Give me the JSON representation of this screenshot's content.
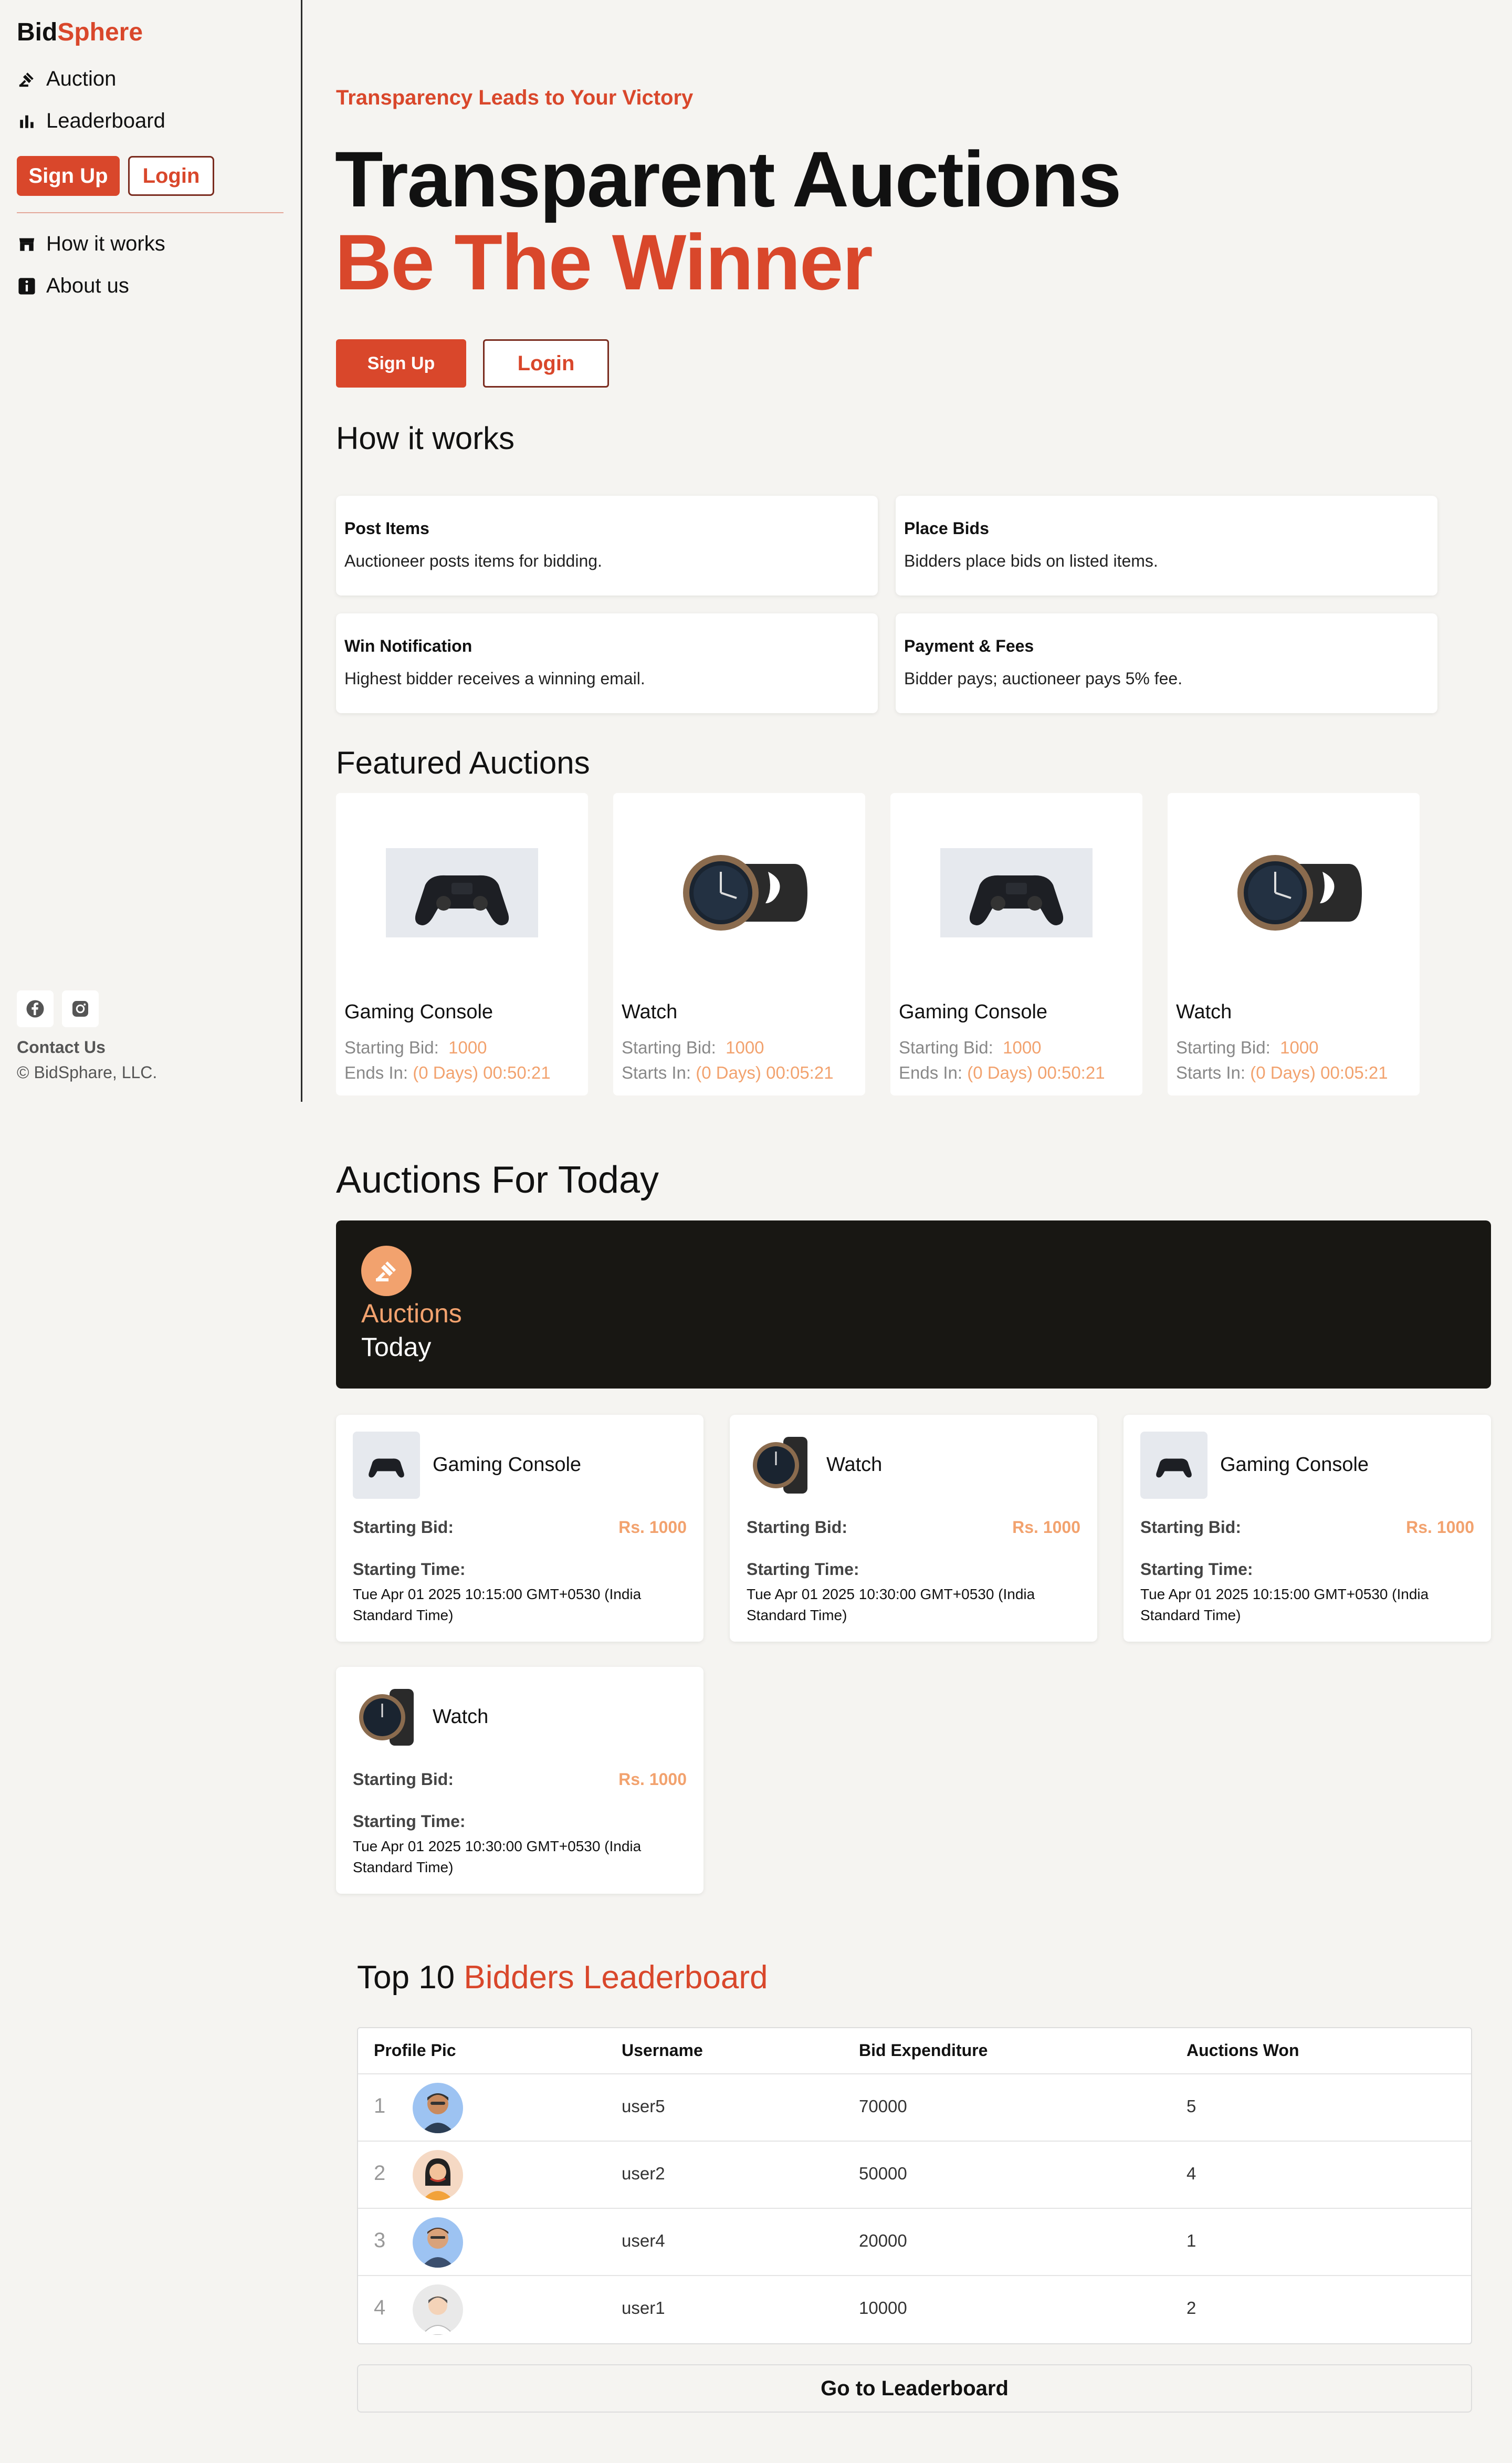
{
  "sidebar": {
    "logo_part1": "Bid",
    "logo_part2": "Sphere",
    "nav": [
      {
        "label": "Auction",
        "icon": "gavel-icon"
      },
      {
        "label": "Leaderboard",
        "icon": "bar-chart-icon"
      }
    ],
    "signup_label": "Sign Up",
    "login_label": "Login",
    "nav2": [
      {
        "label": "How it works",
        "icon": "shop-icon"
      },
      {
        "label": "About us",
        "icon": "info-icon"
      }
    ],
    "social": [
      "facebook-icon",
      "instagram-icon"
    ],
    "contact": "Contact Us",
    "copyright": "© BidSphare, LLC."
  },
  "hero": {
    "tagline": "Transparency Leads to Your Victory",
    "title_line1": "Transparent Auctions",
    "title_line2": "Be The Winner",
    "signup_label": "Sign Up",
    "login_label": "Login"
  },
  "how_it_works": {
    "title": "How it works",
    "cards": [
      {
        "title": "Post Items",
        "desc": "Auctioneer posts items for bidding."
      },
      {
        "title": "Place Bids",
        "desc": "Bidders place bids on listed items."
      },
      {
        "title": "Win Notification",
        "desc": "Highest bidder receives a winning email."
      },
      {
        "title": "Payment & Fees",
        "desc": "Bidder pays; auctioneer pays 5% fee."
      }
    ]
  },
  "featured": {
    "title": "Featured Auctions",
    "items": [
      {
        "name": "Gaming Console",
        "bid_label": "Starting Bid:",
        "bid": "1000",
        "time_label": "Ends In:",
        "time": "(0 Days) 00:50:21",
        "kind": "console"
      },
      {
        "name": "Watch",
        "bid_label": "Starting Bid:",
        "bid": "1000",
        "time_label": "Starts In:",
        "time": "(0 Days) 00:05:21",
        "kind": "watch"
      },
      {
        "name": "Gaming Console",
        "bid_label": "Starting Bid:",
        "bid": "1000",
        "time_label": "Ends In:",
        "time": "(0 Days) 00:50:21",
        "kind": "console"
      },
      {
        "name": "Watch",
        "bid_label": "Starting Bid:",
        "bid": "1000",
        "time_label": "Starts In:",
        "time": "(0 Days) 00:05:21",
        "kind": "watch"
      }
    ]
  },
  "today": {
    "title": "Auctions For Today",
    "banner_line1": "Auctions",
    "banner_line2": "Today",
    "items": [
      {
        "name": "Gaming Console",
        "bid_label": "Starting Bid:",
        "bid": "Rs. 1000",
        "time_label": "Starting Time:",
        "time": "Tue Apr 01 2025 10:15:00 GMT+0530 (India Standard Time)",
        "kind": "console"
      },
      {
        "name": "Watch",
        "bid_label": "Starting Bid:",
        "bid": "Rs. 1000",
        "time_label": "Starting Time:",
        "time": "Tue Apr 01 2025 10:30:00 GMT+0530 (India Standard Time)",
        "kind": "watch"
      },
      {
        "name": "Gaming Console",
        "bid_label": "Starting Bid:",
        "bid": "Rs. 1000",
        "time_label": "Starting Time:",
        "time": "Tue Apr 01 2025 10:15:00 GMT+0530 (India Standard Time)",
        "kind": "console"
      },
      {
        "name": "Watch",
        "bid_label": "Starting Bid:",
        "bid": "Rs. 1000",
        "time_label": "Starting Time:",
        "time": "Tue Apr 01 2025 10:30:00 GMT+0530 (India Standard Time)",
        "kind": "watch"
      }
    ]
  },
  "leaderboard": {
    "title_part1": "Top 10 ",
    "title_part2": "Bidders Leaderboard",
    "columns": [
      "Profile Pic",
      "Username",
      "Bid Expenditure",
      "Auctions Won"
    ],
    "rows": [
      {
        "rank": "1",
        "username": "user5",
        "expenditure": "70000",
        "won": "5",
        "avatar_bg": "#9dc3f2"
      },
      {
        "rank": "2",
        "username": "user2",
        "expenditure": "50000",
        "won": "4",
        "avatar_bg": "#f5d9c4"
      },
      {
        "rank": "3",
        "username": "user4",
        "expenditure": "20000",
        "won": "1",
        "avatar_bg": "#9dc3f2"
      },
      {
        "rank": "4",
        "username": "user1",
        "expenditure": "10000",
        "won": "2",
        "avatar_bg": "#e9e9e9"
      }
    ],
    "button_label": "Go to Leaderboard"
  },
  "colors": {
    "accent": "#d9472b",
    "highlight": "#f2a26e",
    "dark_banner": "#181713",
    "background": "#f5f4f1"
  }
}
